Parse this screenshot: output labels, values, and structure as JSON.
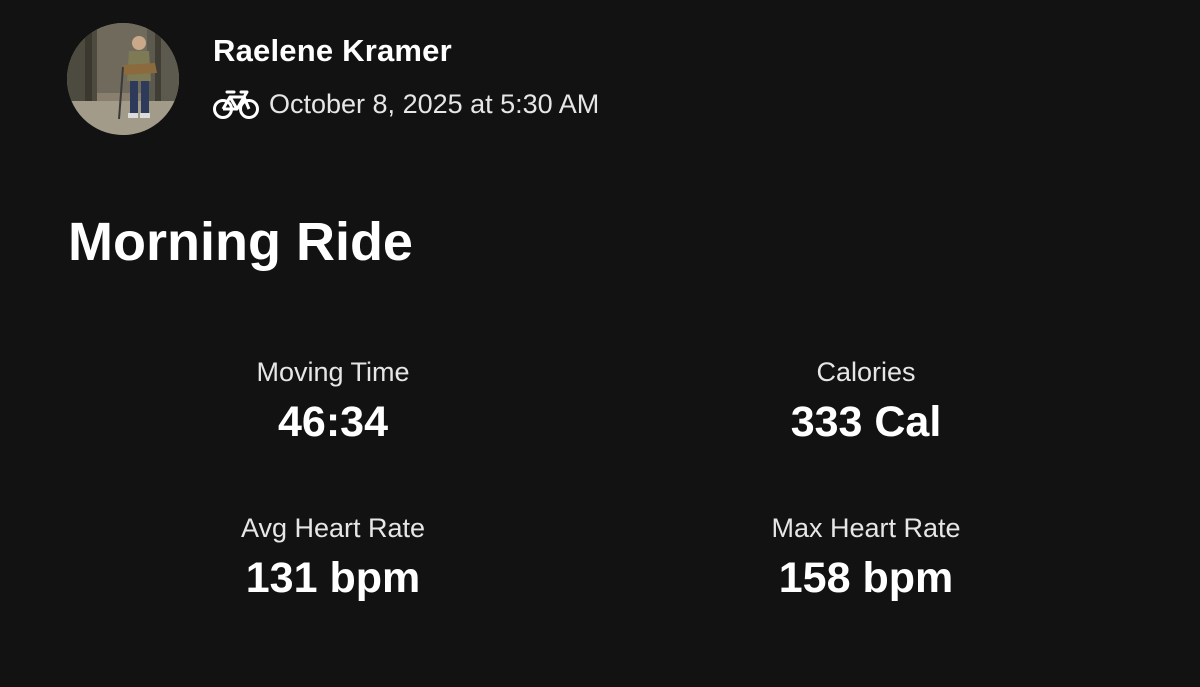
{
  "athlete": {
    "name": "Raelene Kramer",
    "avatar_icon": "avatar-photo"
  },
  "activity": {
    "sport_icon": "bicycle-icon",
    "date": "October 8, 2025 at 5:30 AM",
    "title": "Morning Ride"
  },
  "stats": [
    {
      "label": "Moving Time",
      "value": "46:34"
    },
    {
      "label": "Calories",
      "value": "333 Cal"
    },
    {
      "label": "Avg Heart Rate",
      "value": "131 bpm"
    },
    {
      "label": "Max Heart Rate",
      "value": "158 bpm"
    }
  ],
  "colors": {
    "background": "#121212",
    "text": "#ffffff",
    "secondary_text": "#e6e6e6"
  }
}
